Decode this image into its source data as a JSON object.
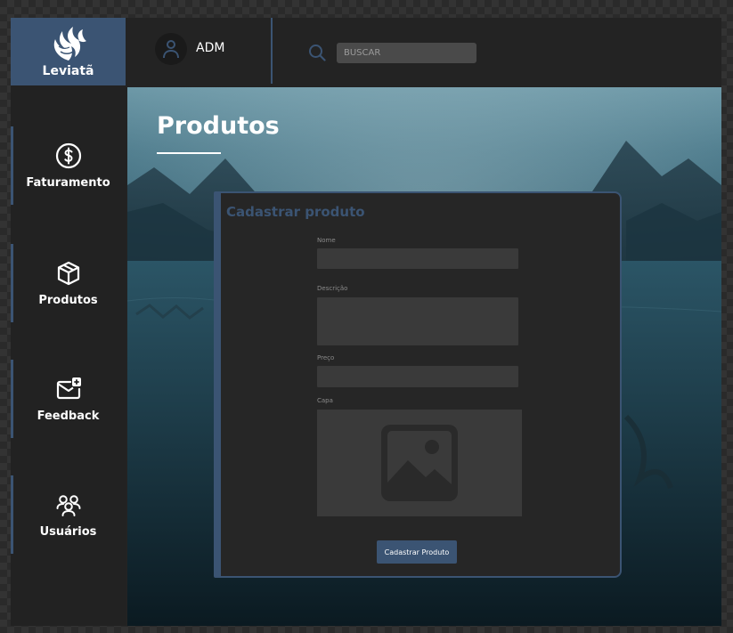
{
  "brand": {
    "name": "Leviatã"
  },
  "sidebar": {
    "items": [
      {
        "label": "Faturamento",
        "icon": "dollar-circle-icon"
      },
      {
        "label": "Produtos",
        "icon": "box-icon"
      },
      {
        "label": "Feedback",
        "icon": "mail-plus-icon"
      },
      {
        "label": "Usuários",
        "icon": "users-icon"
      }
    ]
  },
  "header": {
    "user": "ADM",
    "search": {
      "placeholder": "BUSCAR",
      "value": ""
    }
  },
  "main": {
    "title": "Produtos"
  },
  "form": {
    "title": "Cadastrar produto",
    "fields": {
      "name": {
        "label": "Nome",
        "value": ""
      },
      "description": {
        "label": "Descrição",
        "value": ""
      },
      "price": {
        "label": "Preço",
        "value": ""
      },
      "cover": {
        "label": "Capa"
      }
    },
    "submit_label": "Cadastrar Produto"
  },
  "colors": {
    "accent": "#3b5473",
    "panel": "#262626",
    "sidebar": "#222222",
    "field": "#3a3a3a"
  }
}
